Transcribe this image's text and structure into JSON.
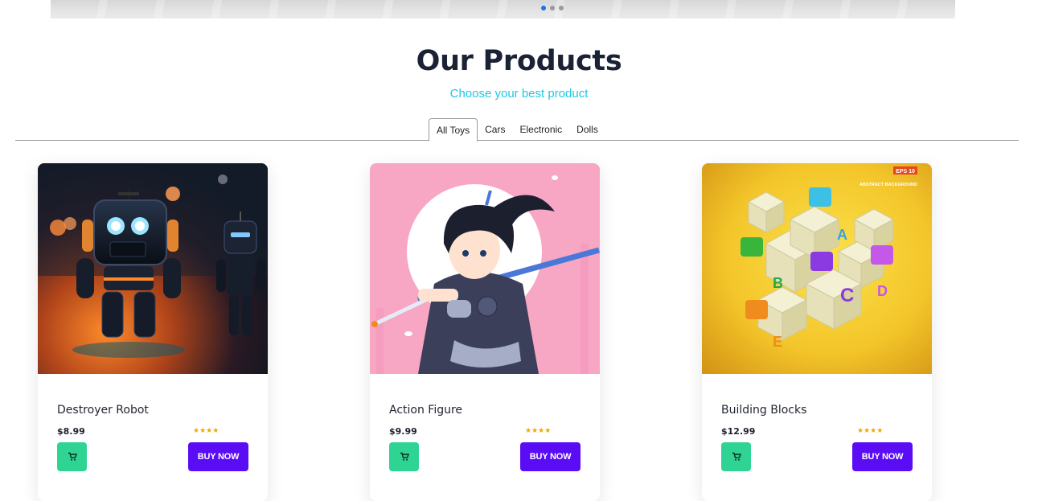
{
  "carousel": {
    "slide_count": 3,
    "active_index": 0
  },
  "section": {
    "title": "Our Products",
    "subtitle": "Choose your best product"
  },
  "tabs": [
    {
      "label": "All Toys",
      "active": true
    },
    {
      "label": "Cars",
      "active": false
    },
    {
      "label": "Electronic",
      "active": false
    },
    {
      "label": "Dolls",
      "active": false
    }
  ],
  "products": [
    {
      "name": "Destroyer Robot",
      "price": "$8.99",
      "rating": "★★★★",
      "buy_label": "BUY NOW",
      "cart_icon": "cart-icon"
    },
    {
      "name": "Action Figure",
      "price": "$9.99",
      "rating": "★★★★",
      "buy_label": "BUY NOW",
      "cart_icon": "cart-icon"
    },
    {
      "name": "Building Blocks",
      "price": "$12.99",
      "rating": "★★★★",
      "buy_label": "BUY NOW",
      "cart_icon": "cart-icon"
    }
  ],
  "blocks_image": {
    "badge": "EPS 10",
    "caption": "ABSTRACT BACKGROUND"
  },
  "colors": {
    "accent": "#5a0cf5",
    "cart": "#2fd494",
    "subtitle": "#1ec7e6",
    "rating": "#f0a800"
  }
}
